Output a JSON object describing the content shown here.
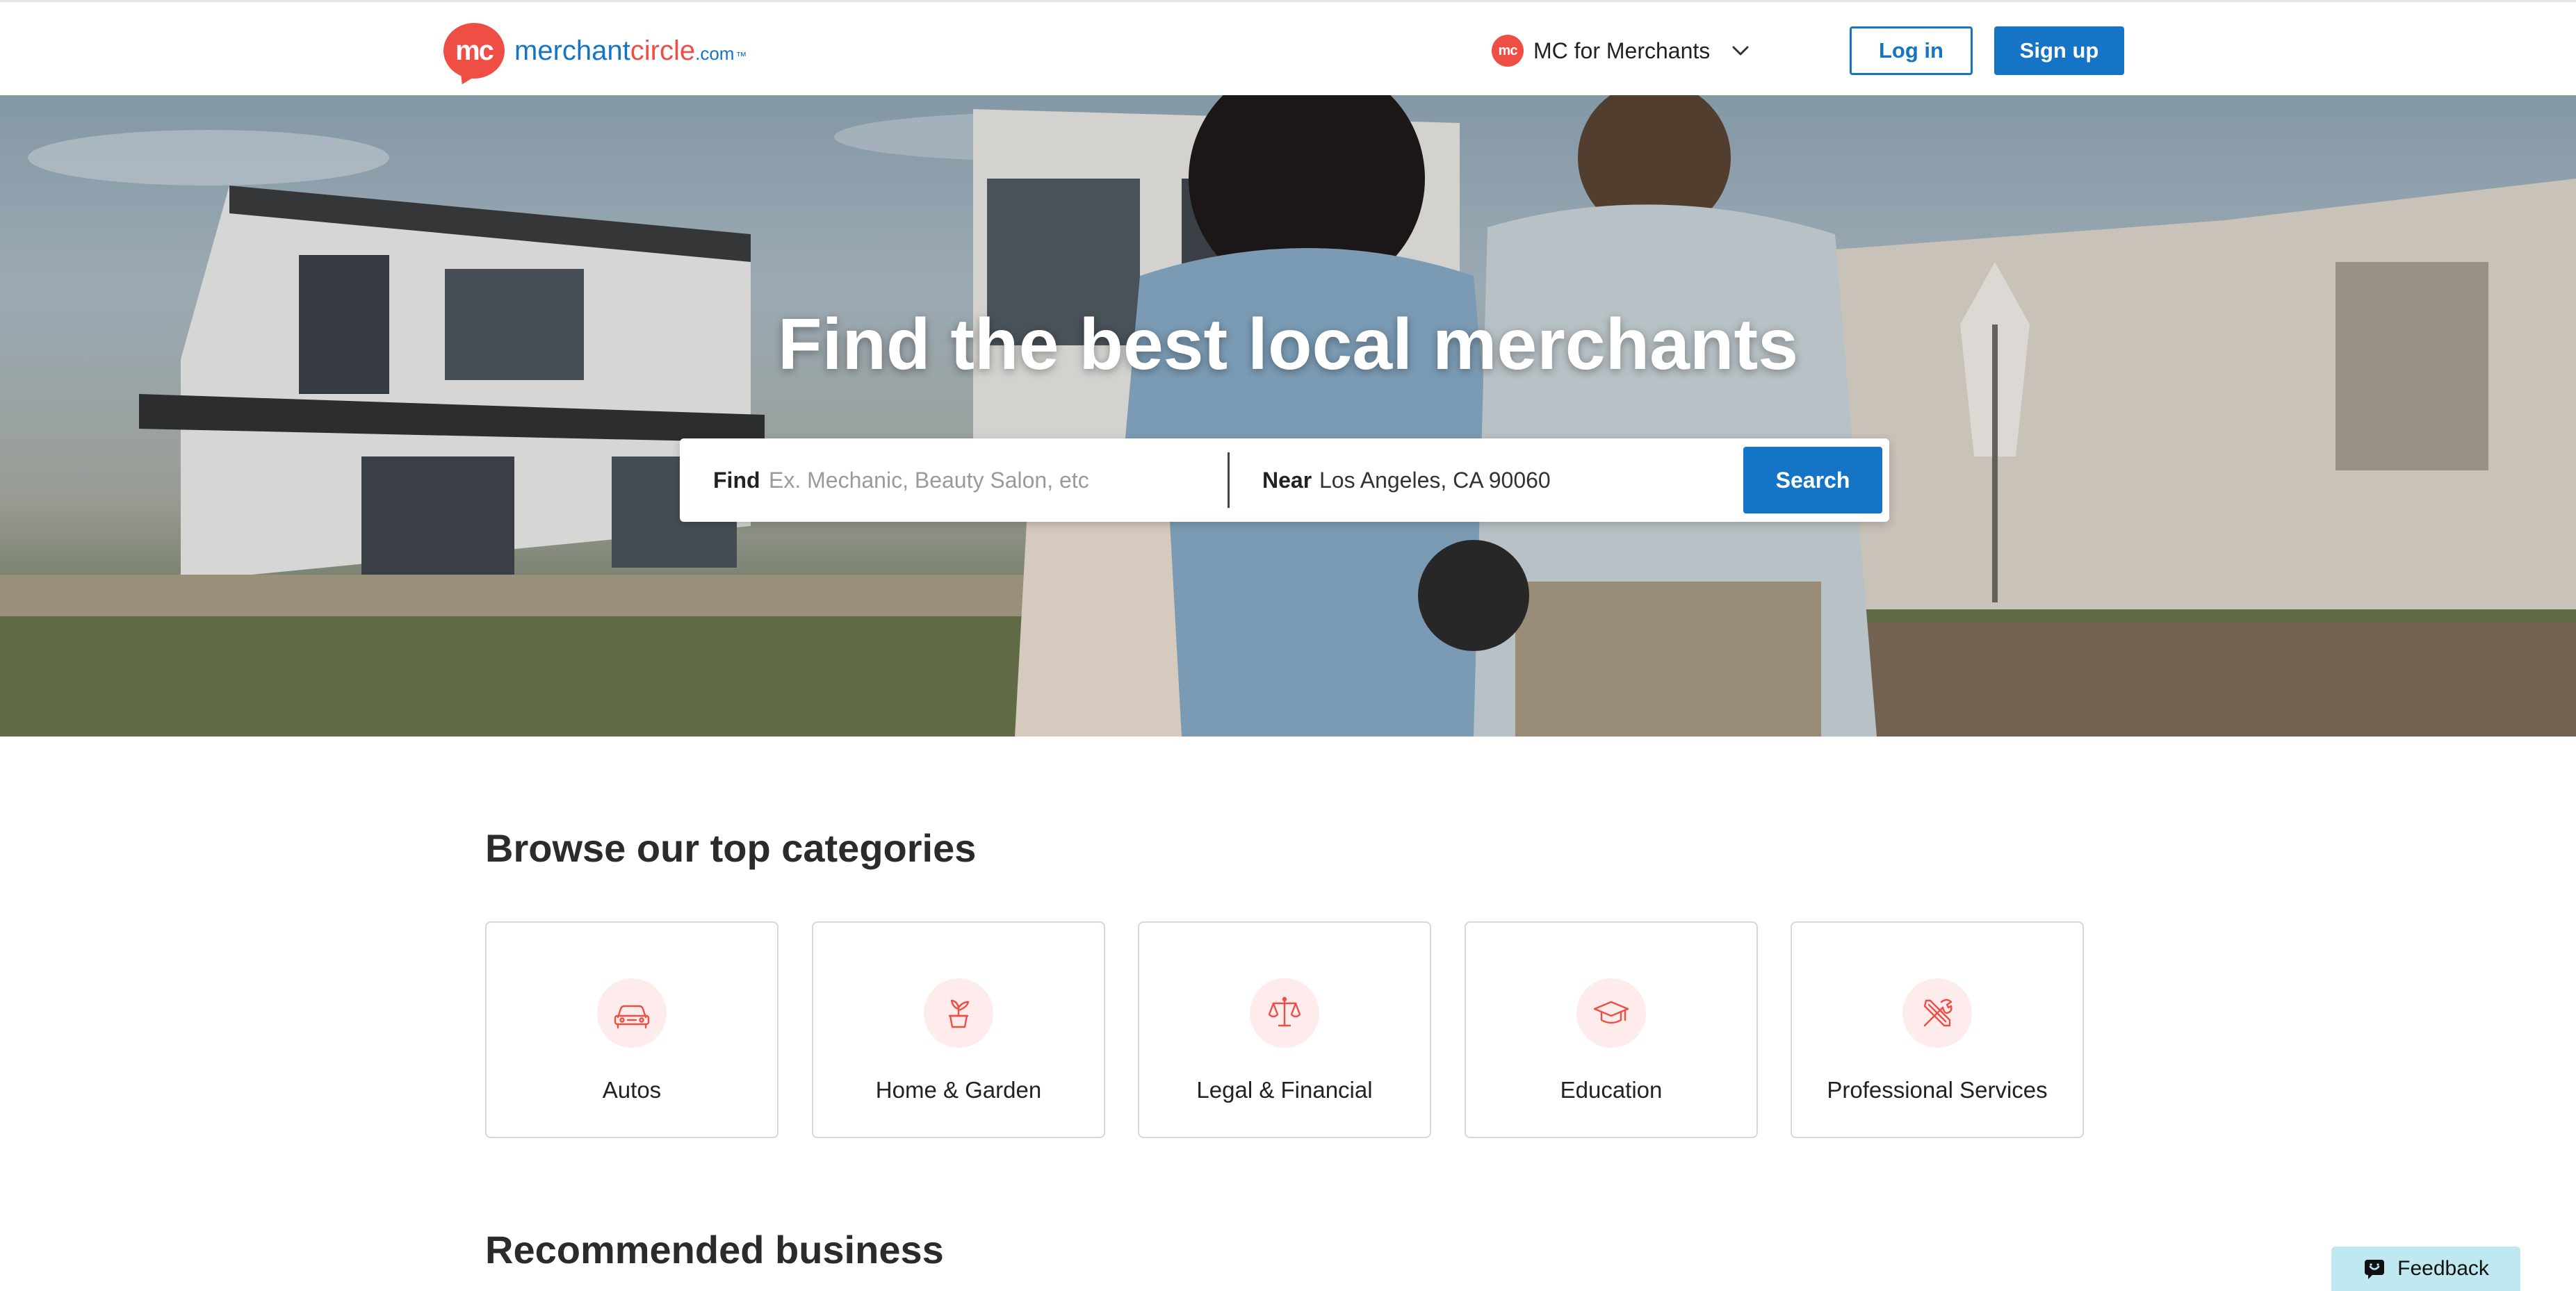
{
  "header": {
    "logo": {
      "badge": "mc",
      "word_part1": "merchant",
      "word_part2": "circle",
      "word_part3": ".com",
      "word_part4": "™"
    },
    "merchants_menu": {
      "badge": "mc",
      "label": "MC for Merchants"
    },
    "login_label": "Log in",
    "signup_label": "Sign up"
  },
  "hero": {
    "title": "Find the best local merchants",
    "search": {
      "find_label": "Find",
      "find_placeholder": "Ex. Mechanic, Beauty Salon, etc",
      "near_label": "Near",
      "near_value": "Los Angeles, CA 90060",
      "search_label": "Search"
    }
  },
  "categories": {
    "title": "Browse our top categories",
    "items": [
      {
        "label": "Autos",
        "icon": "car-icon"
      },
      {
        "label": "Home & Garden",
        "icon": "plant-pot-icon"
      },
      {
        "label": "Legal & Financial",
        "icon": "scales-icon"
      },
      {
        "label": "Education",
        "icon": "graduation-cap-icon"
      },
      {
        "label": "Professional Services",
        "icon": "tools-icon"
      }
    ]
  },
  "recommended": {
    "title": "Recommended business"
  },
  "feedback": {
    "label": "Feedback",
    "icon": "feedback-icon"
  },
  "colors": {
    "brand_blue": "#1574c5",
    "brand_red": "#ef4e45",
    "icon_bg": "#fdeceb",
    "feedback_bg": "#bfe8f0"
  }
}
